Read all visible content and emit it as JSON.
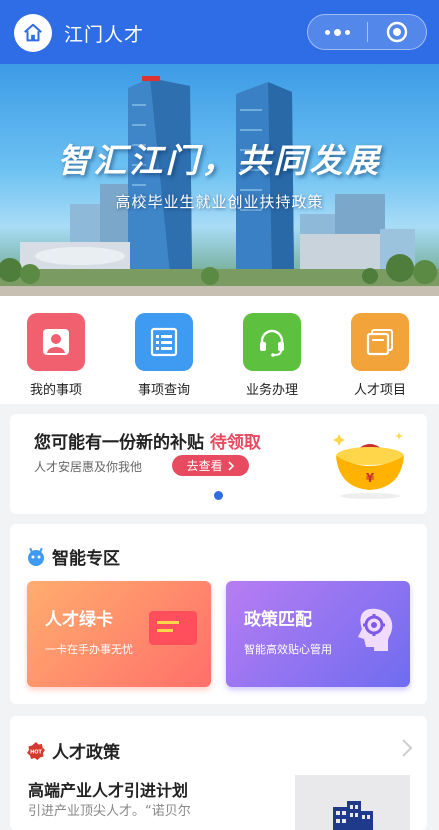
{
  "header": {
    "title": "江门人才",
    "home_icon": "home-icon",
    "menu_icon": "more-dots-icon",
    "close_icon": "target-circle-icon",
    "bg_color": "#2f6de6"
  },
  "banner": {
    "title": "智汇江门，共同发展",
    "subtitle": "高校毕业生就业创业扶持政策"
  },
  "grid": {
    "items": [
      {
        "label": "我的事项",
        "icon": "person-icon",
        "color": "#f0606f"
      },
      {
        "label": "事项查询",
        "icon": "list-icon",
        "color": "#3f9af2"
      },
      {
        "label": "业务办理",
        "icon": "headset-icon",
        "color": "#5dc03e"
      },
      {
        "label": "人才项目",
        "icon": "folder-icon",
        "color": "#f2a33a"
      }
    ]
  },
  "subsidy": {
    "title_prefix": "您可能有一份新的补贴",
    "title_highlight": "待领取",
    "subtitle": "人才安居惠及你我他",
    "button_label": "去查看",
    "accent": "#e84a5f"
  },
  "smart": {
    "title": "智能专区",
    "cards": [
      {
        "title": "人才绿卡",
        "subtitle": "一卡在手办事无忧"
      },
      {
        "title": "政策匹配",
        "subtitle": "智能高效贴心管用"
      }
    ]
  },
  "policy": {
    "title": "人才政策",
    "badge": "HOT",
    "item_title": "高端产业人才引进计划",
    "item_subtitle": "引进产业顶尖人才。“诺贝尔"
  }
}
